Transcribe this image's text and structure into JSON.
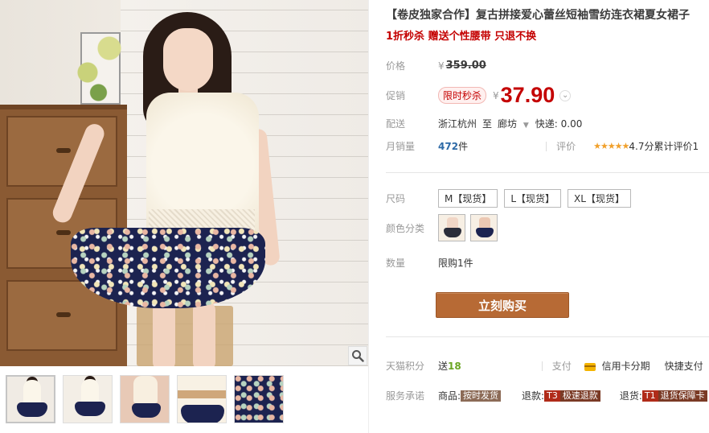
{
  "gallery": {
    "zoom_icon": "magnifier-icon",
    "thumbnails": [
      {
        "name": "front-view",
        "active": true
      },
      {
        "name": "full-body-view",
        "active": false
      },
      {
        "name": "bag-detail-view",
        "active": false
      },
      {
        "name": "belt-detail-view",
        "active": false
      },
      {
        "name": "fabric-pattern-view",
        "active": false
      }
    ]
  },
  "product": {
    "title": "【卷皮独家合作】复古拼接爱心蕾丝短袖雪纺连衣裙夏女裙子",
    "subtitle": "1折秒杀 赠送个性腰带 只退不换"
  },
  "price": {
    "label": "价格",
    "currency": "¥",
    "original": "359.00"
  },
  "promo": {
    "label": "促销",
    "badge": "限时秒杀",
    "currency": "¥",
    "value": "37.90"
  },
  "shipping": {
    "label": "配送",
    "from": "浙江杭州",
    "to_word": "至",
    "dest": "廊坊",
    "express": "快递: 0.00"
  },
  "sales": {
    "label": "月销量",
    "count": "472",
    "unit": "件",
    "rating_label": "评价",
    "stars": "★★★★★",
    "score_text": "4.7分",
    "review_text": "累计评价1"
  },
  "size": {
    "label": "尺码",
    "options": [
      "M【现货】",
      "L【现货】",
      "XL【现货】"
    ]
  },
  "color": {
    "label": "颜色分类"
  },
  "quantity": {
    "label": "数量",
    "limit": "限购1件"
  },
  "buy_button": "立刻购买",
  "tmall_points": {
    "label": "天猫积分",
    "text_prefix": "送",
    "value": "18",
    "pay_label": "支付",
    "credit_text": "信用卡分期",
    "quick_pay": "快捷支付"
  },
  "service": {
    "label": "服务承诺",
    "goods_label": "商品:",
    "goods_tag": "按时发货",
    "refund_label": "退款:",
    "refund_tag_code": "T3",
    "refund_tag": "极速退款",
    "return_label": "退货:",
    "return_tag_code": "T1",
    "return_tag": "退货保障卡"
  },
  "colors": {
    "accent_red": "#c40000",
    "buy_button": "#b76a35",
    "points_green": "#6aa523",
    "link_blue": "#2e6aa7"
  }
}
